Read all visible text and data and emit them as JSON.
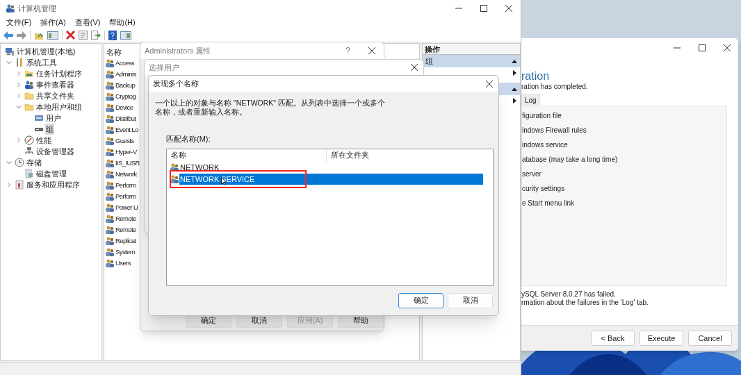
{
  "computer_management": {
    "title": "计算机管理",
    "menu": [
      "文件(F)",
      "操作(A)",
      "查看(V)",
      "帮助(H)"
    ],
    "tree": [
      {
        "label": "计算机管理(本地)",
        "selected": false,
        "children": [
          {
            "label": "系统工具",
            "expanded": true,
            "selected": false,
            "children": [
              {
                "label": "任务计划程序",
                "expanded": false,
                "selected": false
              },
              {
                "label": "事件查看器",
                "expanded": false,
                "selected": false
              },
              {
                "label": "共享文件夹",
                "expanded": false,
                "selected": false
              },
              {
                "label": "本地用户和组",
                "expanded": true,
                "selected": false,
                "children": [
                  {
                    "label": "用户",
                    "selected": false
                  },
                  {
                    "label": "组",
                    "selected": true
                  }
                ]
              },
              {
                "label": "性能",
                "expanded": false,
                "selected": false
              },
              {
                "label": "设备管理器",
                "selected": false
              }
            ]
          },
          {
            "label": "存储",
            "expanded": true,
            "selected": false,
            "children": [
              {
                "label": "磁盘管理",
                "selected": false
              }
            ]
          },
          {
            "label": "服务和应用程序",
            "expanded": false,
            "selected": false
          }
        ]
      }
    ],
    "list": {
      "column": "名称",
      "items": [
        "Access",
        "Adminis",
        "Backup",
        "Cryptog",
        "Device",
        "Distribut",
        "Event Lo",
        "Guests",
        "Hyper-V",
        "IIS_IUSR",
        "Network",
        "Perform",
        "Perform",
        "Power U",
        "Remote",
        "Remote",
        "Replicat",
        "System",
        "Users"
      ]
    },
    "actions": {
      "header": "操作",
      "sections": [
        {
          "title": "组",
          "expanded": true
        },
        {
          "expanded": true
        }
      ]
    }
  },
  "installer": {
    "heading": "ration",
    "subtitle": "ration has completed.",
    "tabs": [
      {
        "label": "Log",
        "selected": false
      }
    ],
    "steps": [
      "figuration file",
      "indows Firewall rules",
      "indows service",
      "atabase (may take a long time)",
      "server",
      "curity settings",
      "e Start menu link"
    ],
    "messages": [
      "ySQL Server 8.0.27 has failed.",
      "rmation about the failures in the 'Log' tab."
    ],
    "buttons": [
      "< Back",
      "Execute",
      "Cancel"
    ]
  },
  "properties_dialog": {
    "title": "Administrators 属性",
    "help_glyph": "?",
    "buttons": [
      {
        "label": "确定",
        "disabled": false
      },
      {
        "label": "取消",
        "disabled": false
      },
      {
        "label": "应用(A)",
        "disabled": true
      },
      {
        "label": "帮助",
        "disabled": false
      }
    ]
  },
  "select_users_dialog": {
    "title": "选择用户"
  },
  "multiple_names_dialog": {
    "title": "发现多个名称",
    "message": "一个以上的对象与名称 \"NETWORK\" 匹配。从列表中选择一个或多个名称，或者重新输入名称。",
    "list_label": "匹配名称(M):",
    "columns": [
      "名称",
      "所在文件夹"
    ],
    "rows": [
      {
        "name": "NETWORK",
        "selected": false
      },
      {
        "name": "NETWORK SERVICE",
        "selected": true
      }
    ],
    "buttons": [
      {
        "label": "确定",
        "focused": true
      },
      {
        "label": "取消",
        "focused": false
      }
    ]
  }
}
